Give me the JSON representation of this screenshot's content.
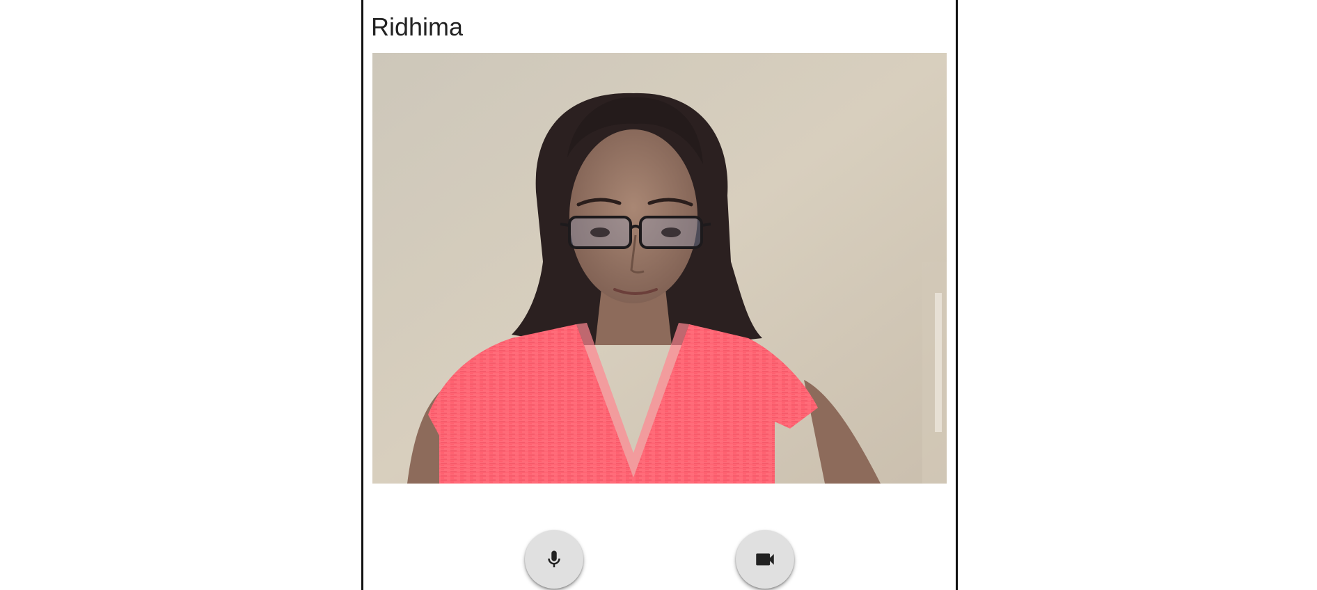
{
  "participant": {
    "name": "Ridhima"
  },
  "video": {
    "description_icon": "webcam-video-frame"
  },
  "controls": {
    "mic_icon": "microphone-icon",
    "camera_icon": "video-camera-icon"
  },
  "colors": {
    "card_border": "#111111",
    "button_bg": "#e0e0e0",
    "icon": "#222222",
    "name_text": "#222222"
  }
}
